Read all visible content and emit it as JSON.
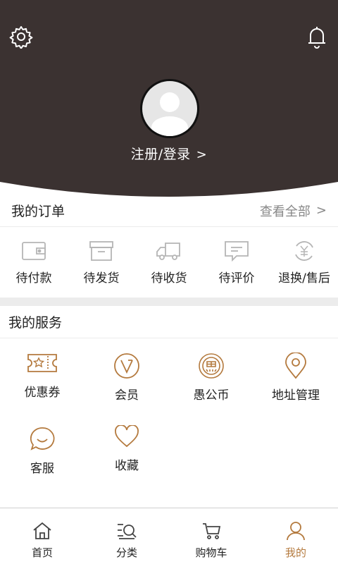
{
  "header": {
    "settings_icon": "gear-icon",
    "notify_icon": "bell-icon",
    "login_text": "注册/登录",
    "login_chevron": ">"
  },
  "orders": {
    "title": "我的订单",
    "view_all": "查看全部",
    "chevron": ">",
    "items": [
      {
        "label": "待付款",
        "icon": "wallet-icon"
      },
      {
        "label": "待发货",
        "icon": "package-box-icon"
      },
      {
        "label": "待收货",
        "icon": "truck-icon"
      },
      {
        "label": "待评价",
        "icon": "comment-icon"
      },
      {
        "label": "退换/售后",
        "icon": "refund-yen-icon"
      }
    ]
  },
  "services": {
    "title": "我的服务",
    "items": [
      {
        "label": "优惠券",
        "icon": "coupon-icon"
      },
      {
        "label": "会员",
        "icon": "vip-icon"
      },
      {
        "label": "愚公币",
        "icon": "coin-icon"
      },
      {
        "label": "地址管理",
        "icon": "location-pin-icon"
      },
      {
        "label": "客服",
        "icon": "customer-service-icon"
      },
      {
        "label": "收藏",
        "icon": "heart-icon"
      }
    ]
  },
  "tabbar": {
    "items": [
      {
        "label": "首页",
        "icon": "home-icon",
        "active": false
      },
      {
        "label": "分类",
        "icon": "category-search-icon",
        "active": false
      },
      {
        "label": "购物车",
        "icon": "cart-icon",
        "active": false
      },
      {
        "label": "我的",
        "icon": "user-icon",
        "active": true
      }
    ]
  },
  "colors": {
    "header_bg": "#3b3231",
    "accent": "#b47a3e",
    "order_icon_gray": "#b5b5b5",
    "divider": "#ececec"
  }
}
